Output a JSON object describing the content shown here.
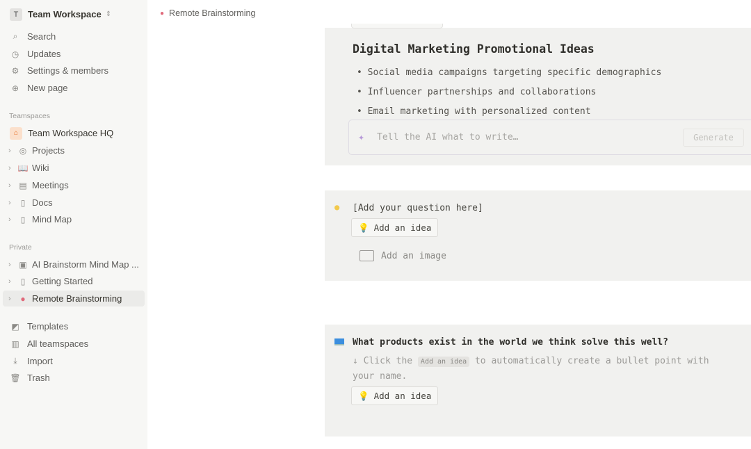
{
  "sidebar": {
    "workspace": {
      "initial": "T",
      "name": "Team Workspace"
    },
    "top": [
      {
        "icon": "search-icon",
        "label": "Search"
      },
      {
        "icon": "clock-icon",
        "label": "Updates"
      },
      {
        "icon": "gear-icon",
        "label": "Settings & members"
      },
      {
        "icon": "plus-circle-icon",
        "label": "New page"
      }
    ],
    "teamspaces_label": "Teamspaces",
    "teamspaces": [
      {
        "icon": "home-icon",
        "label": "Team Workspace HQ"
      },
      {
        "icon": "target-icon",
        "label": "Projects"
      },
      {
        "icon": "book-icon",
        "label": "Wiki"
      },
      {
        "icon": "calendar-icon",
        "label": "Meetings"
      },
      {
        "icon": "document-icon",
        "label": "Docs"
      },
      {
        "icon": "page-icon",
        "label": "Mind Map"
      }
    ],
    "private_label": "Private",
    "private": [
      {
        "icon": "board-icon",
        "label": "AI Brainstorm Mind Map ..."
      },
      {
        "icon": "document-icon",
        "label": "Getting Started"
      },
      {
        "icon": "brain-icon",
        "label": "Remote Brainstorming",
        "active": true
      }
    ],
    "bottom": [
      {
        "icon": "templates-icon",
        "label": "Templates"
      },
      {
        "icon": "building-icon",
        "label": "All teamspaces"
      },
      {
        "icon": "import-icon",
        "label": "Import"
      },
      {
        "icon": "trash-icon",
        "label": "Trash"
      }
    ]
  },
  "breadcrumb": {
    "label": "Remote Brainstorming"
  },
  "ai_block": {
    "title": "Digital Marketing Promotional Ideas",
    "bullets": [
      "Social media campaigns targeting specific demographics",
      "Influencer partnerships and collaborations",
      "Email marketing with personalized content"
    ],
    "placeholder": "Tell the AI what to write…",
    "generate": "Generate"
  },
  "question_block": {
    "question": "[Add your question here]",
    "add_idea": "Add an idea",
    "add_image": "Add an image"
  },
  "products_block": {
    "question": "What products exist in the world we think solve this well?",
    "hint_pre": "↓ Click the",
    "hint_chip": "Add an idea",
    "hint_post": "to automatically create a bullet point with your name.",
    "add_idea": "Add an idea"
  },
  "colors": {
    "sidebar_bg": "#f7f7f5",
    "card_bg": "#f1f1ef",
    "ai_accent": "#a77fd0"
  }
}
